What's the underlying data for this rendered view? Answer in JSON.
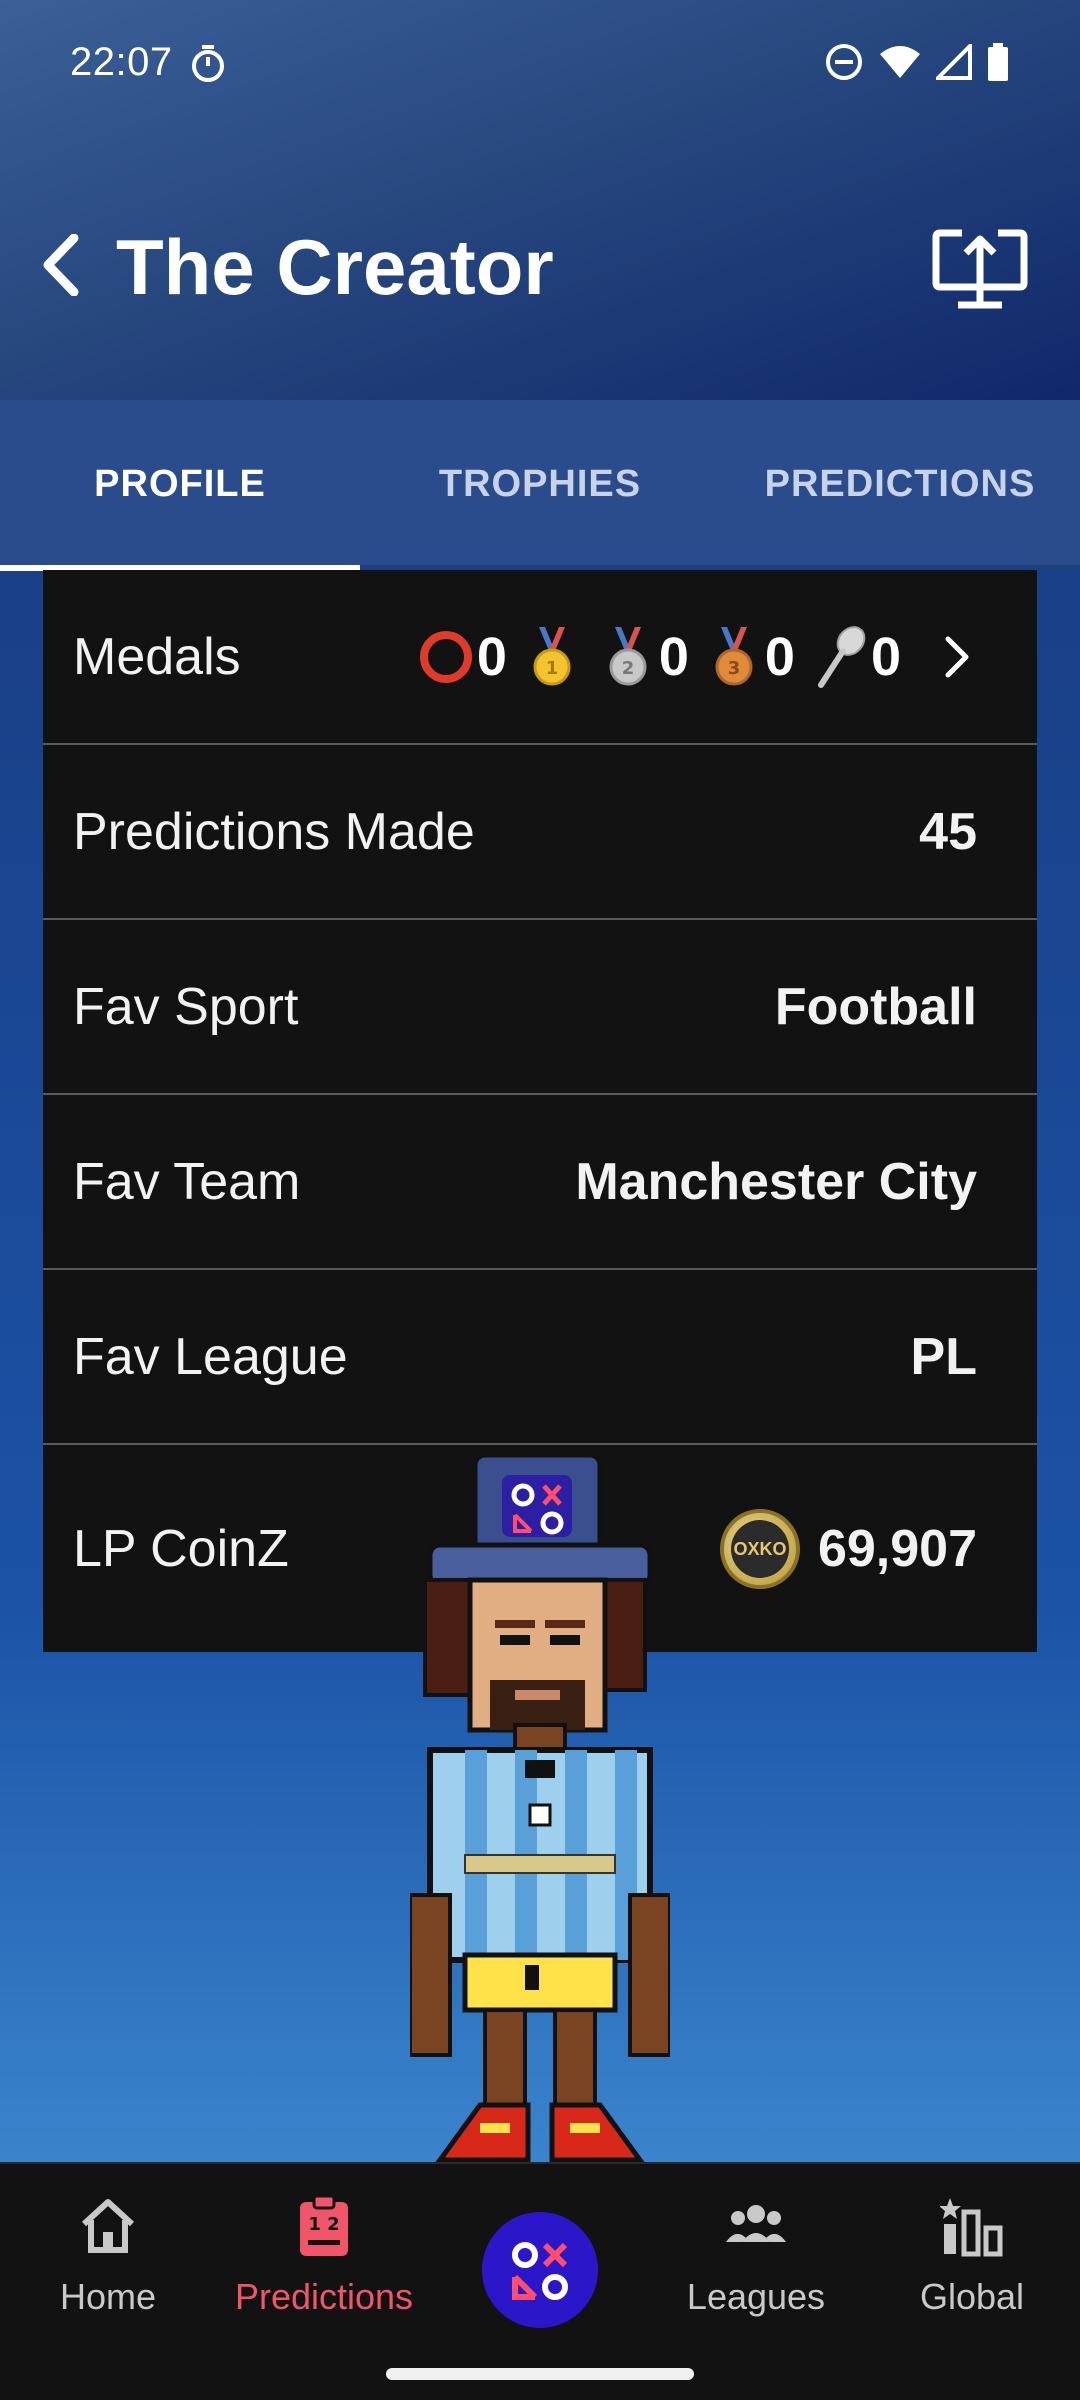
{
  "status_bar": {
    "time": "22:07"
  },
  "header": {
    "title": "The Creator"
  },
  "tabs": [
    {
      "label": "PROFILE",
      "active": true
    },
    {
      "label": "TROPHIES",
      "active": false
    },
    {
      "label": "PREDICTIONS",
      "active": false
    }
  ],
  "profile": {
    "medals": {
      "label": "Medals",
      "items": [
        {
          "icon": "ring-icon",
          "count": "0"
        },
        {
          "icon": "gold-medal-icon",
          "count": ""
        },
        {
          "icon": "silver-medal-icon",
          "count": "0"
        },
        {
          "icon": "bronze-medal-icon",
          "count": "0"
        },
        {
          "icon": "wooden-spoon-icon",
          "count": "0"
        }
      ]
    },
    "predictions_made": {
      "label": "Predictions Made",
      "value": "45"
    },
    "fav_sport": {
      "label": "Fav Sport",
      "value": "Football"
    },
    "fav_team": {
      "label": "Fav Team",
      "value": "Manchester City"
    },
    "fav_league": {
      "label": "Fav League",
      "value": "PL"
    },
    "lp_coinz": {
      "label": "LP CoinZ",
      "value": "69,907",
      "coin_text_top": "OX",
      "coin_text_bottom": "KO"
    }
  },
  "bottom_nav": {
    "items": [
      {
        "label": "Home",
        "icon": "home-icon",
        "active": false
      },
      {
        "label": "Predictions",
        "icon": "clipboard-icon",
        "active": true
      },
      {
        "label": "",
        "icon": "oxko-logo-icon",
        "active": false
      },
      {
        "label": "Leagues",
        "icon": "group-icon",
        "active": false
      },
      {
        "label": "Global",
        "icon": "leaderboard-icon",
        "active": false
      }
    ]
  },
  "colors": {
    "active_tab": "#ffffff",
    "nav_active": "#f0556a",
    "center_button": "#2b17c9",
    "card_background": "#121212"
  }
}
